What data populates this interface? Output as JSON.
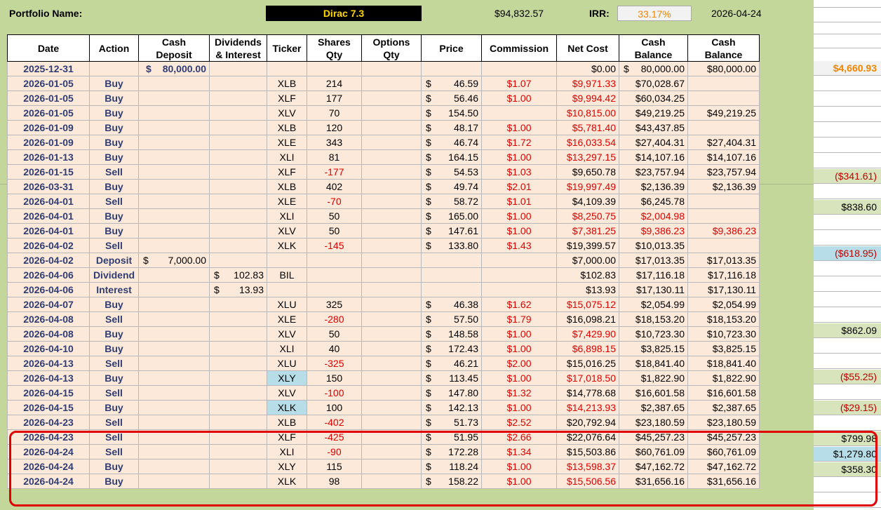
{
  "header": {
    "portfolio_label": "Portfolio Name:",
    "portfolio_name": "Dirac 7.3",
    "portfolio_value": "$94,832.57",
    "irr_label": "IRR:",
    "irr_value": "33.17%",
    "date": "2026-04-24"
  },
  "columns": {
    "date": "Date",
    "action": "Action",
    "cash_deposit": [
      "Cash",
      "Deposit"
    ],
    "dividends": [
      "Dividends",
      "& Interest"
    ],
    "ticker": "Ticker",
    "shares": [
      "Shares",
      "Qty"
    ],
    "options": [
      "Options",
      "Qty"
    ],
    "price": "Price",
    "commission": "Commission",
    "net_cost": "Net Cost",
    "cash_balance_1": [
      "Cash",
      "Balance"
    ],
    "cash_balance_2": [
      "Cash",
      "Balance"
    ]
  },
  "rows": [
    {
      "date": "2025-12-31",
      "action": "",
      "deposit": "80,000.00",
      "dividend": "",
      "ticker": "",
      "qty": "",
      "price": "",
      "commission": "",
      "net_cost": "$0.00",
      "net_red": false,
      "bal1": "80,000.00",
      "bal1_dollar": true,
      "bal2": "$80,000.00"
    },
    {
      "date": "2026-01-05",
      "action": "Buy",
      "deposit": "",
      "dividend": "",
      "ticker": "XLB",
      "qty": "214",
      "price": "46.59",
      "commission": "$1.07",
      "net_cost": "$9,971.33",
      "net_red": true,
      "bal1": "$70,028.67",
      "bal2": ""
    },
    {
      "date": "2026-01-05",
      "action": "Buy",
      "deposit": "",
      "dividend": "",
      "ticker": "XLF",
      "qty": "177",
      "price": "56.46",
      "commission": "$1.00",
      "net_cost": "$9,994.42",
      "net_red": true,
      "bal1": "$60,034.25",
      "bal2": ""
    },
    {
      "date": "2026-01-05",
      "action": "Buy",
      "deposit": "",
      "dividend": "",
      "ticker": "XLV",
      "qty": "70",
      "price": "154.50",
      "commission": "",
      "net_cost": "$10,815.00",
      "net_red": true,
      "bal1": "$49,219.25",
      "bal2": "$49,219.25"
    },
    {
      "date": "2026-01-09",
      "action": "Buy",
      "deposit": "",
      "dividend": "",
      "ticker": "XLB",
      "qty": "120",
      "price": "48.17",
      "commission": "$1.00",
      "net_cost": "$5,781.40",
      "net_red": true,
      "bal1": "$43,437.85",
      "bal2": ""
    },
    {
      "date": "2026-01-09",
      "action": "Buy",
      "deposit": "",
      "dividend": "",
      "ticker": "XLE",
      "qty": "343",
      "price": "46.74",
      "commission": "$1.72",
      "net_cost": "$16,033.54",
      "net_red": true,
      "bal1": "$27,404.31",
      "bal2": "$27,404.31"
    },
    {
      "date": "2026-01-13",
      "action": "Buy",
      "deposit": "",
      "dividend": "",
      "ticker": "XLI",
      "qty": "81",
      "price": "164.15",
      "commission": "$1.00",
      "net_cost": "$13,297.15",
      "net_red": true,
      "bal1": "$14,107.16",
      "bal2": "$14,107.16"
    },
    {
      "date": "2026-01-15",
      "action": "Sell",
      "deposit": "",
      "dividend": "",
      "ticker": "XLF",
      "qty": "-177",
      "price": "54.53",
      "commission": "$1.03",
      "net_cost": "$9,650.78",
      "net_red": false,
      "bal1": "$23,757.94",
      "bal2": "$23,757.94"
    },
    {
      "date": "2026-03-31",
      "action": "Buy",
      "deposit": "",
      "dividend": "",
      "ticker": "XLB",
      "qty": "402",
      "price": "49.74",
      "commission": "$2.01",
      "net_cost": "$19,997.49",
      "net_red": true,
      "bal1": "$2,136.39",
      "bal2": "$2,136.39"
    },
    {
      "date": "2026-04-01",
      "action": "Sell",
      "deposit": "",
      "dividend": "",
      "ticker": "XLE",
      "qty": "-70",
      "price": "58.72",
      "commission": "$1.01",
      "net_cost": "$4,109.39",
      "net_red": false,
      "bal1": "$6,245.78",
      "bal2": ""
    },
    {
      "date": "2026-04-01",
      "action": "Buy",
      "deposit": "",
      "dividend": "",
      "ticker": "XLI",
      "qty": "50",
      "price": "165.00",
      "commission": "$1.00",
      "net_cost": "$8,250.75",
      "net_red": true,
      "bal1": "$2,004.98",
      "bal1_red": true,
      "bal2": ""
    },
    {
      "date": "2026-04-01",
      "action": "Buy",
      "deposit": "",
      "dividend": "",
      "ticker": "XLV",
      "qty": "50",
      "price": "147.61",
      "commission": "$1.00",
      "net_cost": "$7,381.25",
      "net_red": true,
      "bal1": "$9,386.23",
      "bal1_red": true,
      "bal2": "$9,386.23",
      "bal2_red": true
    },
    {
      "date": "2026-04-02",
      "action": "Sell",
      "deposit": "",
      "dividend": "",
      "ticker": "XLK",
      "qty": "-145",
      "price": "133.80",
      "commission": "$1.43",
      "net_cost": "$19,399.57",
      "net_red": false,
      "bal1": "$10,013.35",
      "bal2": ""
    },
    {
      "date": "2026-04-02",
      "action": "Deposit",
      "deposit": "7,000.00",
      "dividend": "",
      "ticker": "",
      "qty": "",
      "price": "",
      "commission": "",
      "net_cost": "$7,000.00",
      "net_red": false,
      "bal1": "$17,013.35",
      "bal2": "$17,013.35"
    },
    {
      "date": "2026-04-06",
      "action": "Dividend",
      "deposit": "",
      "dividend": "102.83",
      "ticker": "BIL",
      "qty": "",
      "price": "",
      "commission": "",
      "net_cost": "$102.83",
      "net_red": false,
      "bal1": "$17,116.18",
      "bal2": "$17,116.18"
    },
    {
      "date": "2026-04-06",
      "action": "Interest",
      "deposit": "",
      "dividend": "13.93",
      "ticker": "",
      "qty": "",
      "price": "",
      "commission": "",
      "net_cost": "$13.93",
      "net_red": false,
      "bal1": "$17,130.11",
      "bal2": "$17,130.11"
    },
    {
      "date": "2026-04-07",
      "action": "Buy",
      "deposit": "",
      "dividend": "",
      "ticker": "XLU",
      "qty": "325",
      "price": "46.38",
      "commission": "$1.62",
      "net_cost": "$15,075.12",
      "net_red": true,
      "bal1": "$2,054.99",
      "bal2": "$2,054.99"
    },
    {
      "date": "2026-04-08",
      "action": "Sell",
      "deposit": "",
      "dividend": "",
      "ticker": "XLE",
      "qty": "-280",
      "price": "57.50",
      "commission": "$1.79",
      "net_cost": "$16,098.21",
      "net_red": false,
      "bal1": "$18,153.20",
      "bal2": "$18,153.20"
    },
    {
      "date": "2026-04-08",
      "action": "Buy",
      "deposit": "",
      "dividend": "",
      "ticker": "XLV",
      "qty": "50",
      "price": "148.58",
      "commission": "$1.00",
      "net_cost": "$7,429.90",
      "net_red": true,
      "bal1": "$10,723.30",
      "bal2": "$10,723.30"
    },
    {
      "date": "2026-04-10",
      "action": "Buy",
      "deposit": "",
      "dividend": "",
      "ticker": "XLI",
      "qty": "40",
      "price": "172.43",
      "commission": "$1.00",
      "net_cost": "$6,898.15",
      "net_red": true,
      "bal1": "$3,825.15",
      "bal2": "$3,825.15"
    },
    {
      "date": "2026-04-13",
      "action": "Sell",
      "deposit": "",
      "dividend": "",
      "ticker": "XLU",
      "qty": "-325",
      "price": "46.21",
      "commission": "$2.00",
      "net_cost": "$15,016.25",
      "net_red": false,
      "bal1": "$18,841.40",
      "bal2": "$18,841.40"
    },
    {
      "date": "2026-04-13",
      "action": "Buy",
      "deposit": "",
      "dividend": "",
      "ticker": "XLY",
      "ticker_hl": true,
      "qty": "150",
      "price": "113.45",
      "commission": "$1.00",
      "net_cost": "$17,018.50",
      "net_red": true,
      "bal1": "$1,822.90",
      "bal2": "$1,822.90"
    },
    {
      "date": "2026-04-15",
      "action": "Sell",
      "deposit": "",
      "dividend": "",
      "ticker": "XLV",
      "qty": "-100",
      "price": "147.80",
      "commission": "$1.32",
      "net_cost": "$14,778.68",
      "net_red": false,
      "bal1": "$16,601.58",
      "bal2": "$16,601.58"
    },
    {
      "date": "2026-04-15",
      "action": "Buy",
      "deposit": "",
      "dividend": "",
      "ticker": "XLK",
      "ticker_hl": true,
      "qty": "100",
      "price": "142.13",
      "commission": "$1.00",
      "net_cost": "$14,213.93",
      "net_red": true,
      "bal1": "$2,387.65",
      "bal2": "$2,387.65"
    },
    {
      "date": "2026-04-23",
      "action": "Sell",
      "deposit": "",
      "dividend": "",
      "ticker": "XLB",
      "qty": "-402",
      "price": "51.73",
      "commission": "$2.52",
      "net_cost": "$20,792.94",
      "net_red": false,
      "bal1": "$23,180.59",
      "bal2": "$23,180.59"
    },
    {
      "date": "2026-04-23",
      "action": "Sell",
      "deposit": "",
      "dividend": "",
      "ticker": "XLF",
      "qty": "-425",
      "price": "51.95",
      "commission": "$2.66",
      "net_cost": "$22,076.64",
      "net_red": false,
      "bal1": "$45,257.23",
      "bal2": "$45,257.23"
    },
    {
      "date": "2026-04-24",
      "action": "Sell",
      "deposit": "",
      "dividend": "",
      "ticker": "XLI",
      "qty": "-90",
      "price": "172.28",
      "commission": "$1.34",
      "net_cost": "$15,503.86",
      "net_red": false,
      "bal1": "$60,761.09",
      "bal2": "$60,761.09"
    },
    {
      "date": "2026-04-24",
      "action": "Buy",
      "deposit": "",
      "dividend": "",
      "ticker": "XLY",
      "qty": "115",
      "price": "118.24",
      "commission": "$1.00",
      "net_cost": "$13,598.37",
      "net_red": true,
      "bal1": "$47,162.72",
      "bal2": "$47,162.72"
    },
    {
      "date": "2026-04-24",
      "action": "Buy",
      "deposit": "",
      "dividend": "",
      "ticker": "XLK",
      "qty": "98",
      "price": "158.22",
      "commission": "$1.00",
      "net_cost": "$15,506.56",
      "net_red": true,
      "bal1": "$31,656.16",
      "bal2": "$31,656.16"
    }
  ],
  "side_values": [
    {
      "row": 0,
      "text": "$4,660.93",
      "style": "o"
    },
    {
      "row": 7,
      "text": "($341.61)",
      "style": "g r"
    },
    {
      "row": 9,
      "text": "$838.60",
      "style": "g"
    },
    {
      "row": 12,
      "text": "($618.95)",
      "style": "b r"
    },
    {
      "row": 17,
      "text": "$862.09",
      "style": "g"
    },
    {
      "row": 20,
      "text": "($55.25)",
      "style": "g r"
    },
    {
      "row": 22,
      "text": "($29.15)",
      "style": "g r"
    },
    {
      "row": 24,
      "text": "$799.98",
      "style": "g"
    },
    {
      "row": 25,
      "text": "$1,279.80",
      "style": "b"
    },
    {
      "row": 26,
      "text": "$358.30",
      "style": "g"
    }
  ],
  "currency_symbol": "$"
}
